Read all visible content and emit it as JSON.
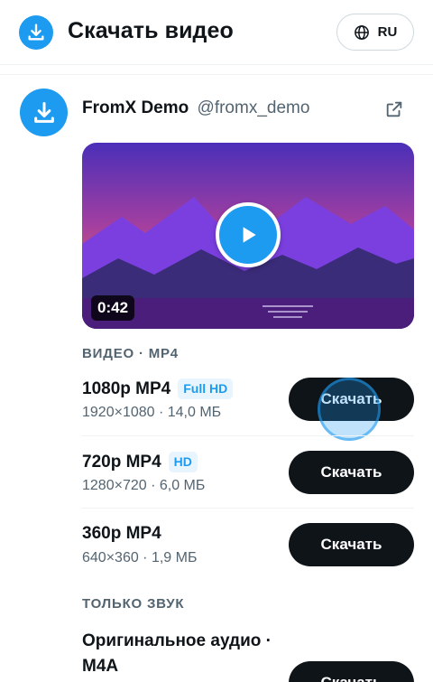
{
  "header": {
    "title": "Скачать видео",
    "lang_label": "RU"
  },
  "post": {
    "author_name": "FromX Demo",
    "author_handle": "@fromx_demo",
    "video_duration": "0:42"
  },
  "sections": {
    "video_label": "ВИДЕО · MP4",
    "audio_label": "ТОЛЬКО ЗВУК"
  },
  "formats": [
    {
      "title": "1080p MP4",
      "badge": "Full HD",
      "meta": "1920×1080 · 14,0 МБ",
      "button": "Скачать"
    },
    {
      "title": "720p MP4",
      "badge": "HD",
      "meta": "1280×720 · 6,0 МБ",
      "button": "Скачать"
    },
    {
      "title": "360p MP4",
      "badge": "",
      "meta": "640×360 · 1,9 МБ",
      "button": "Скачать"
    }
  ],
  "audio": {
    "title": "Оригинальное аудио · M4A",
    "button": "Скачать"
  },
  "colors": {
    "accent": "#1d9bf0",
    "button_dark": "#0f1419",
    "muted_text": "#536471"
  },
  "icons": {
    "logo": "download-icon",
    "lang": "globe-icon",
    "external": "external-link-icon",
    "play": "play-icon"
  }
}
